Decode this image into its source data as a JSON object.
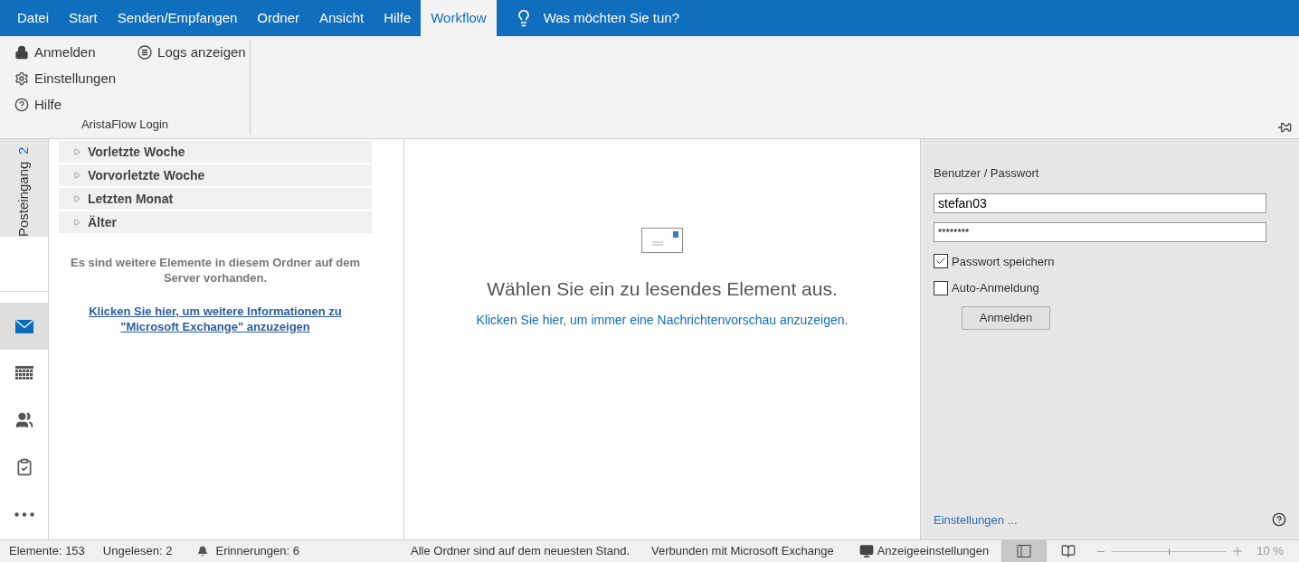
{
  "menu_tabs": [
    {
      "label": "Datei",
      "selected": false
    },
    {
      "label": "Start",
      "selected": false
    },
    {
      "label": "Senden/Empfangen",
      "selected": false
    },
    {
      "label": "Ordner",
      "selected": false
    },
    {
      "label": "Ansicht",
      "selected": false
    },
    {
      "label": "Hilfe",
      "selected": false
    },
    {
      "label": "Workflow",
      "selected": true
    }
  ],
  "tell_me": {
    "placeholder": "Was möchten Sie tun?"
  },
  "ribbon": {
    "group_label": "AristaFlow Login",
    "buttons": [
      {
        "kind": "lock",
        "label": "Anmelden"
      },
      {
        "kind": "gear",
        "label": "Einstellungen"
      },
      {
        "kind": "help",
        "label": "Hilfe"
      },
      {
        "kind": "list",
        "label": "Logs anzeigen"
      }
    ]
  },
  "folder_rail": {
    "label": "Posteingang",
    "count": "2"
  },
  "nav_icons": [
    {
      "kind": "mail",
      "selected": true
    },
    {
      "kind": "calendar",
      "selected": false
    },
    {
      "kind": "people",
      "selected": false
    },
    {
      "kind": "tasks",
      "selected": false
    },
    {
      "kind": "more",
      "selected": false
    }
  ],
  "groups": [
    {
      "label": "Vorletzte Woche",
      "expanded": false
    },
    {
      "label": "Vorvorletzte Woche",
      "expanded": false
    },
    {
      "label": "Letzten Monat",
      "expanded": false
    },
    {
      "label": "Älter",
      "expanded": false
    }
  ],
  "server_note": "Es sind weitere Elemente in diesem Ordner auf dem Server vorhanden.",
  "server_link": "Klicken Sie hier, um weitere Informationen zu \"Microsoft Exchange\" anzuzeigen",
  "reading_pane": {
    "message": "Wählen Sie ein zu lesendes Element aus.",
    "link": "Klicken Sie hier, um immer eine Nachrichtenvorschau anzuzeigen."
  },
  "login_pane": {
    "heading": "Benutzer / Passwort",
    "username": "stefan03",
    "password": "********",
    "options": [
      {
        "label": "Passwort speichern",
        "checked": true
      },
      {
        "label": "Auto-Anmeldung",
        "checked": false
      }
    ],
    "button": "Anmelden",
    "settings_link": "Einstellungen ..."
  },
  "status_bar": {
    "items": [
      "Elemente: 153",
      "Ungelesen: 2"
    ],
    "reminders": "Erinnerungen: 6",
    "sync": "Alle Ordner sind auf dem neuesten Stand.",
    "connection": "Verbunden mit Microsoft Exchange",
    "display_settings": "Anzeigeeinstellungen",
    "zoom": {
      "level": 0.5,
      "reading": "10 %"
    }
  }
}
